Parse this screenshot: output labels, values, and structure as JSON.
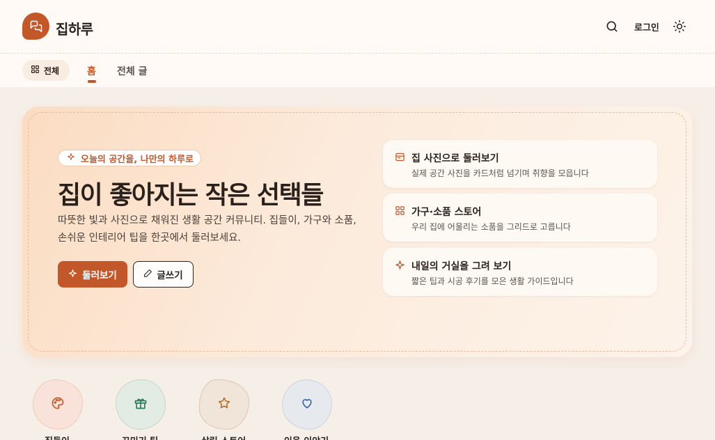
{
  "header": {
    "brand": "집하루",
    "login_label": "로그인"
  },
  "nav": {
    "category_button": "전체",
    "tabs": [
      {
        "label": "홈",
        "active": true
      },
      {
        "label": "전체 글",
        "active": false
      }
    ]
  },
  "hero": {
    "eyebrow": "오늘의 공간을, 나만의 하루로",
    "title": "집이 좋아지는 작은 선택들",
    "description": "따뜻한 빛과 사진으로 채워진 생활 공간 커뮤니티. 집들이, 가구와 소품, 손쉬운 인테리어 팁을 한곳에서 둘러보세요.",
    "primary_button": "둘러보기",
    "secondary_button": "글쓰기"
  },
  "features": [
    {
      "icon": "image-icon",
      "title": "집 사진으로 둘러보기",
      "description": "실제 공간 사진을 카드처럼 넘기며 취향을 모읍니다"
    },
    {
      "icon": "grid-icon",
      "title": "가구·소품 스토어",
      "description": "우리 집에 어울리는 소품을 그리드로 고릅니다"
    },
    {
      "icon": "sparkle-icon",
      "title": "내일의 거실을 그려 보기",
      "description": "짧은 팁과 시공 후기를 모은 생활 가이드입니다"
    }
  ],
  "categories": [
    {
      "icon": "palette-icon",
      "label": "집들이",
      "bg": "#f8e2d9",
      "color": "#c2582a"
    },
    {
      "icon": "gift-icon",
      "label": "꾸미기 팁",
      "bg": "#e3ece4",
      "color": "#2f7a5a"
    },
    {
      "icon": "star-icon",
      "label": "살림 스토어",
      "bg": "#f1e4d8",
      "color": "#b06a2c"
    },
    {
      "icon": "heart-icon",
      "label": "이웃 이야기",
      "bg": "#e6e9ee",
      "color": "#3a6aa6"
    }
  ],
  "colors": {
    "accent": "#c2582a",
    "text": "#2b211c",
    "background": "#f6efe8"
  }
}
